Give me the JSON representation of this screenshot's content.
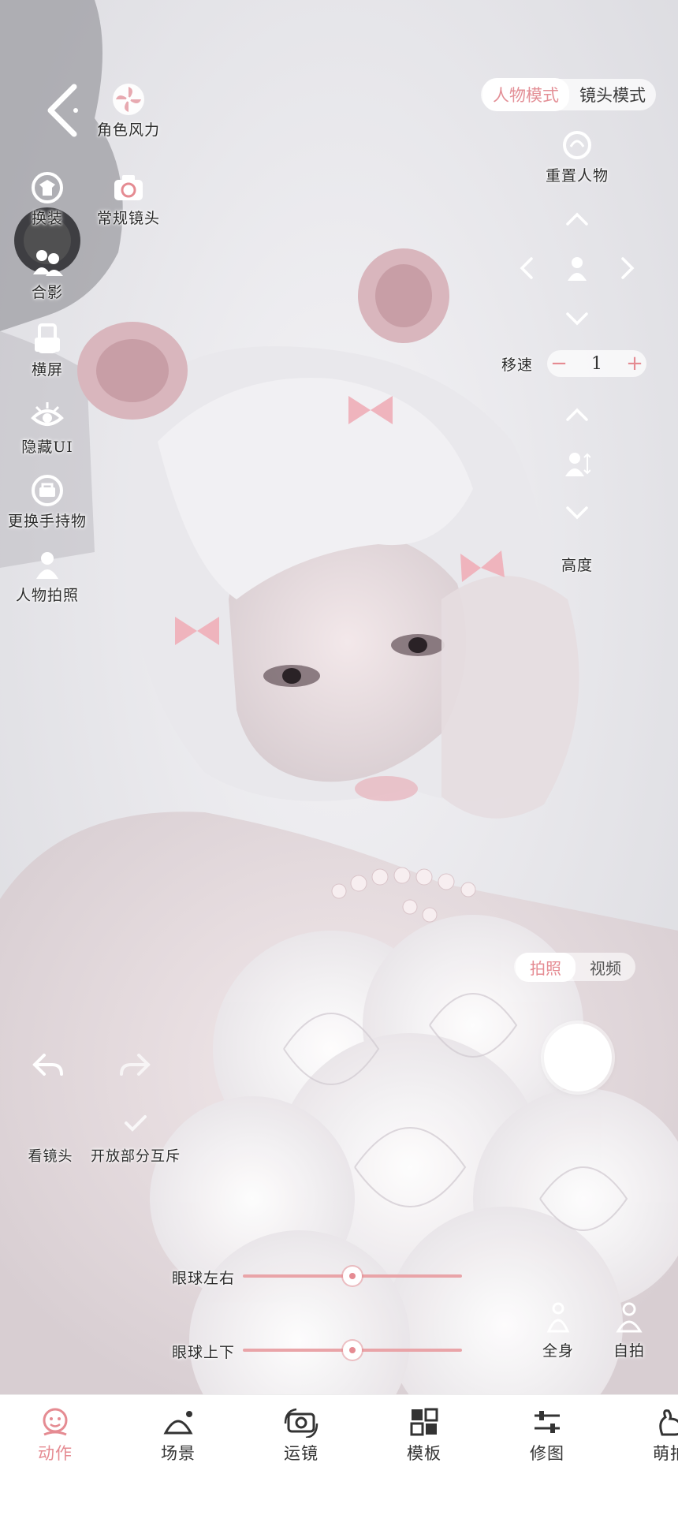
{
  "mode_toggle": {
    "active": "人物模式",
    "inactive": "镜头模式"
  },
  "left_tools": [
    {
      "label": "角色风力",
      "icon": "fan-icon"
    },
    {
      "label": "换装",
      "icon": "outfit-swap-icon"
    },
    {
      "label": "常规镜头",
      "icon": "camera-icon"
    },
    {
      "label": "合影",
      "icon": "group-photo-icon"
    },
    {
      "label": "横屏",
      "icon": "rotate-screen-icon"
    },
    {
      "label": "隐藏UI",
      "icon": "eye-hide-icon"
    },
    {
      "label": "更换手持物",
      "icon": "swap-handheld-icon"
    },
    {
      "label": "人物拍照",
      "icon": "person-photo-icon"
    }
  ],
  "right_tools": {
    "reset_label": "重置人物",
    "speed_label": "移速",
    "speed_value": "1",
    "speed_minus": "−",
    "speed_plus": "+",
    "height_label": "高度"
  },
  "capture_toggle": {
    "active": "拍照",
    "inactive": "视频"
  },
  "bottom_left": {
    "look_label": "看镜头",
    "interact_label": "开放部分互斥"
  },
  "sliders": [
    {
      "label": "眼球左右",
      "value": 0.5
    },
    {
      "label": "眼球上下",
      "value": 0.5
    }
  ],
  "view_buttons": {
    "full_body": "全身",
    "selfie": "自拍"
  },
  "bottom_nav": [
    {
      "label": "动作",
      "icon": "motion-icon",
      "active": true
    },
    {
      "label": "场景",
      "icon": "scene-icon",
      "active": false
    },
    {
      "label": "运镜",
      "icon": "camera-move-icon",
      "active": false
    },
    {
      "label": "模板",
      "icon": "template-icon",
      "active": false
    },
    {
      "label": "修图",
      "icon": "retouch-icon",
      "active": false
    },
    {
      "label": "萌拍",
      "icon": "cute-icon",
      "active": false
    }
  ],
  "colors": {
    "accent": "#e58b92",
    "text": "#2b2b2b",
    "nav_bg": "#ffffff"
  }
}
